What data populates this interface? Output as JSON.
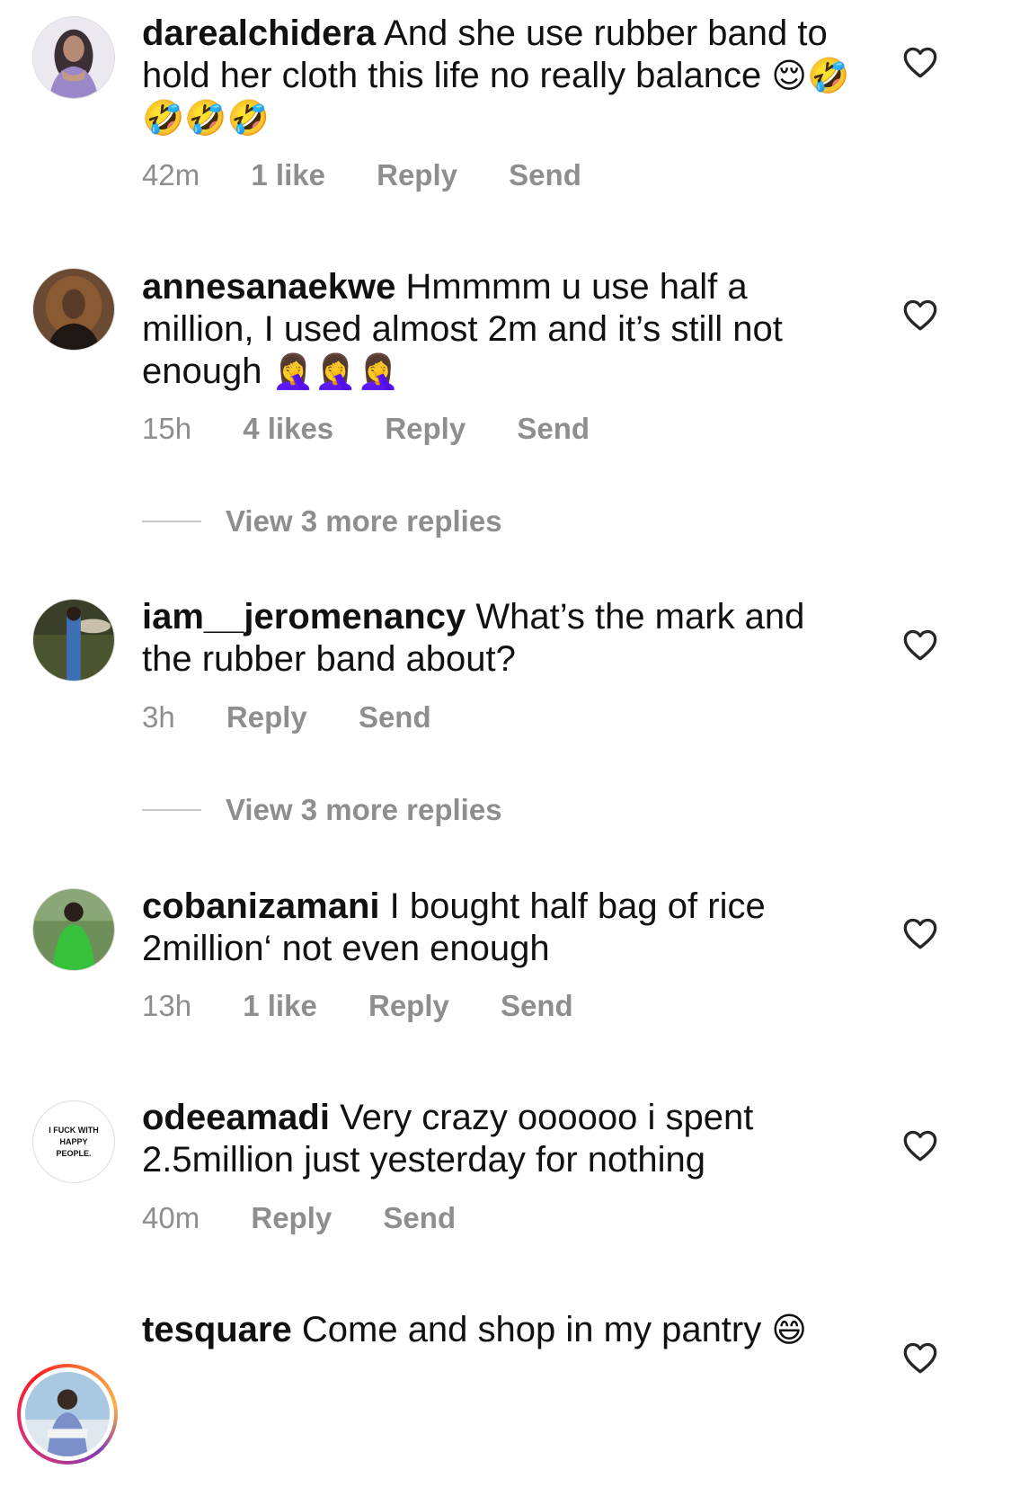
{
  "comments": [
    {
      "username": "darealchidera",
      "text": "And she use rubber band to hold her cloth this life no really balance",
      "emoji": "😌🤣🤣🤣🤣",
      "time": "42m",
      "likes": "1 like",
      "reply": "Reply",
      "send": "Send"
    },
    {
      "username": "annesanaekwe",
      "text": "Hmmmm u use half a million, I used almost 2m and it’s still not enough",
      "emoji": "🤦‍♀️🤦‍♀️🤦‍♀️",
      "time": "15h",
      "likes": "4 likes",
      "reply": "Reply",
      "send": "Send"
    },
    {
      "username": "iam__jeromenancy",
      "text": "What’s the mark and the rubber band about?",
      "time": "3h",
      "reply": "Reply",
      "send": "Send"
    },
    {
      "username": "cobanizamani",
      "text": "I bought half bag of rice 2million‘ not even enough",
      "time": "13h",
      "likes": "1 like",
      "reply": "Reply",
      "send": "Send"
    },
    {
      "username": "odeeamadi",
      "text": "Very crazy oooooo i spent 2.5million just yesterday for nothing",
      "avatar_text": "I FUCK WITH HAPPY PEOPLE.",
      "time": "40m",
      "reply": "Reply",
      "send": "Send"
    },
    {
      "username": "tesquare",
      "text": "Come and shop in my pantry",
      "emoji": "😄"
    }
  ],
  "view_replies": [
    {
      "label": "View 3 more replies"
    },
    {
      "label": "View 3 more replies"
    }
  ],
  "colors": {
    "text": "#111111",
    "secondary": "#8e8e8e",
    "divider": "#c7c7c7",
    "background": "#ffffff"
  },
  "icons": {
    "like": "heart-outline-icon"
  }
}
